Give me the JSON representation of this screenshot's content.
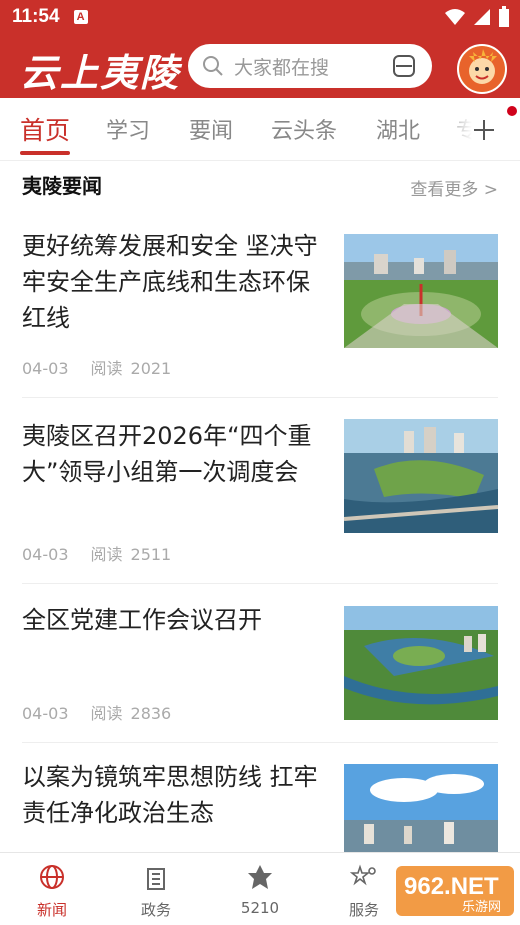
{
  "status": {
    "time": "11:54",
    "a_badge": "A"
  },
  "header": {
    "logo": "云上夷陵",
    "search_placeholder": "大家都在搜"
  },
  "tabs": [
    "首页",
    "学习",
    "要闻",
    "云头条",
    "湖北",
    "专"
  ],
  "section": {
    "title": "夷陵要闻",
    "more": "查看更多 >"
  },
  "news": [
    {
      "title": "更好统筹发展和安全 坚决守牢安全生产底线和生态环保红线",
      "date": "04-03",
      "read_label": "阅读",
      "reads": "2021"
    },
    {
      "title": "夷陵区召开2026年“四个重大”领导小组第一次调度会",
      "date": "04-03",
      "read_label": "阅读",
      "reads": "2511"
    },
    {
      "title": "全区党建工作会议召开",
      "date": "04-03",
      "read_label": "阅读",
      "reads": "2836"
    },
    {
      "title": "以案为镜筑牢思想防线 扛牢责任净化政治生态",
      "date": "",
      "read_label": "",
      "reads": ""
    }
  ],
  "bottom_nav": [
    {
      "label": "新闻",
      "icon": "globe-icon"
    },
    {
      "label": "政务",
      "icon": "building-icon"
    },
    {
      "label": "5210",
      "icon": "leaf-icon"
    },
    {
      "label": "服务",
      "icon": "stars-icon"
    }
  ],
  "watermark": {
    "text": "962.NET",
    "sub": "乐游网"
  },
  "colors": {
    "brand": "#c9302a"
  }
}
